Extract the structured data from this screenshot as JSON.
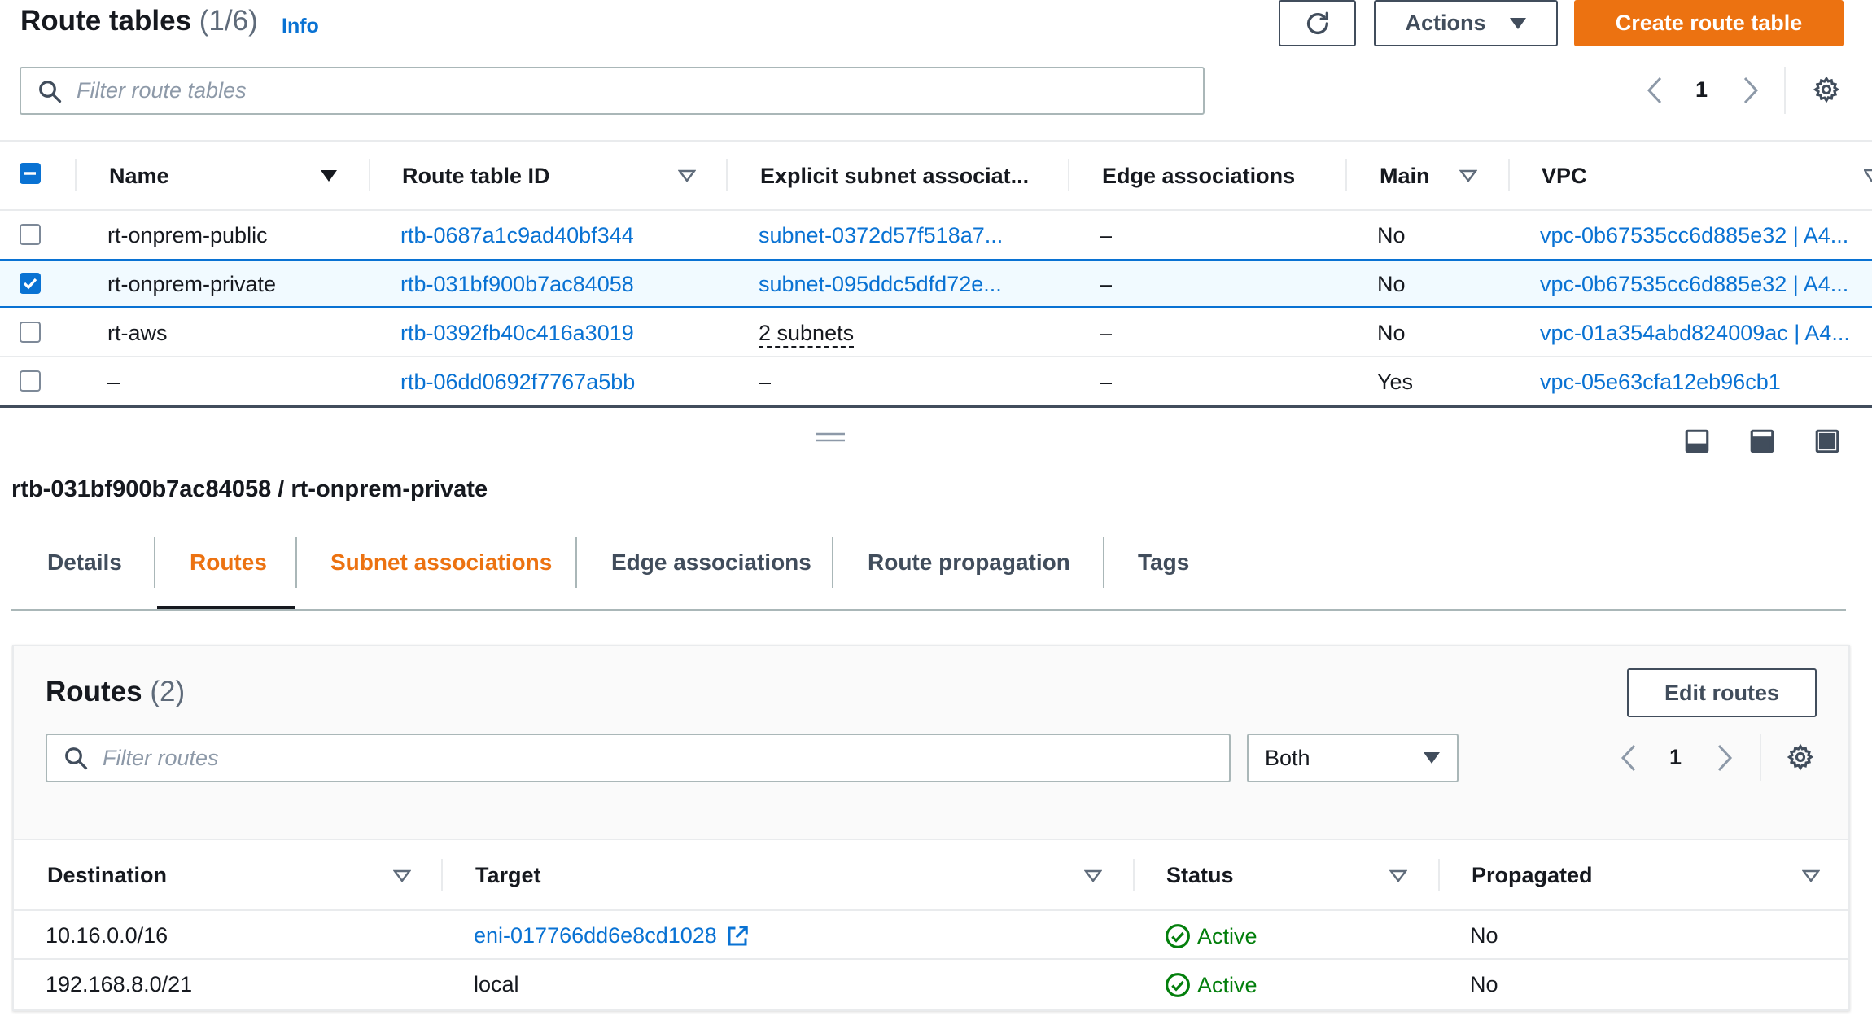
{
  "header": {
    "title": "Route tables",
    "count": "(1/6)",
    "info": "Info",
    "actions_label": "Actions",
    "create_label": "Create route table"
  },
  "filter": {
    "placeholder": "Filter route tables"
  },
  "pagination": {
    "page": "1"
  },
  "table": {
    "columns": [
      "Name",
      "Route table ID",
      "Explicit subnet associat...",
      "Edge associations",
      "Main",
      "VPC"
    ],
    "rows": [
      {
        "name": "rt-onprem-public",
        "id": "rtb-0687a1c9ad40bf344",
        "subnet": "subnet-0372d57f518a7...",
        "edge": "–",
        "main": "No",
        "vpc": "vpc-0b67535cc6d885e32 | A4...",
        "selected": false
      },
      {
        "name": "rt-onprem-private",
        "id": "rtb-031bf900b7ac84058",
        "subnet": "subnet-095ddc5dfd72e...",
        "edge": "–",
        "main": "No",
        "vpc": "vpc-0b67535cc6d885e32 | A4...",
        "selected": true
      },
      {
        "name": "rt-aws",
        "id": "rtb-0392fb40c416a3019",
        "subnet": "2 subnets",
        "edge": "–",
        "main": "No",
        "vpc": "vpc-01a354abd824009ac | A4...",
        "selected": false
      },
      {
        "name": "–",
        "id": "rtb-06dd0692f7767a5bb",
        "subnet": "–",
        "edge": "–",
        "main": "Yes",
        "vpc": "vpc-05e63cfa12eb96cb1",
        "selected": false
      }
    ]
  },
  "detail": {
    "title": "rtb-031bf900b7ac84058 / rt-onprem-private",
    "tabs": [
      "Details",
      "Routes",
      "Subnet associations",
      "Edge associations",
      "Route propagation",
      "Tags"
    ],
    "active_tab": "Routes"
  },
  "routes": {
    "title": "Routes",
    "count": "(2)",
    "edit_label": "Edit routes",
    "filter_placeholder": "Filter routes",
    "select_value": "Both",
    "page": "1",
    "columns": [
      "Destination",
      "Target",
      "Status",
      "Propagated"
    ],
    "rows": [
      {
        "destination": "10.16.0.0/16",
        "target": "eni-017766dd6e8cd1028",
        "status": "Active",
        "propagated": "No"
      },
      {
        "destination": "192.168.8.0/21",
        "target": "local",
        "status": "Active",
        "propagated": "No"
      }
    ]
  },
  "colors": {
    "accent": "#ec7211",
    "link": "#0972d3",
    "success": "#037f0c"
  },
  "icons": [
    "refresh-icon",
    "caret-down-icon",
    "search-icon",
    "chevron-left-icon",
    "chevron-right-icon",
    "gear-icon",
    "sort-icon",
    "external-link-icon",
    "status-success-icon",
    "panel-bottom-icon",
    "panel-side-icon",
    "panel-full-icon",
    "drag-handle-icon"
  ]
}
